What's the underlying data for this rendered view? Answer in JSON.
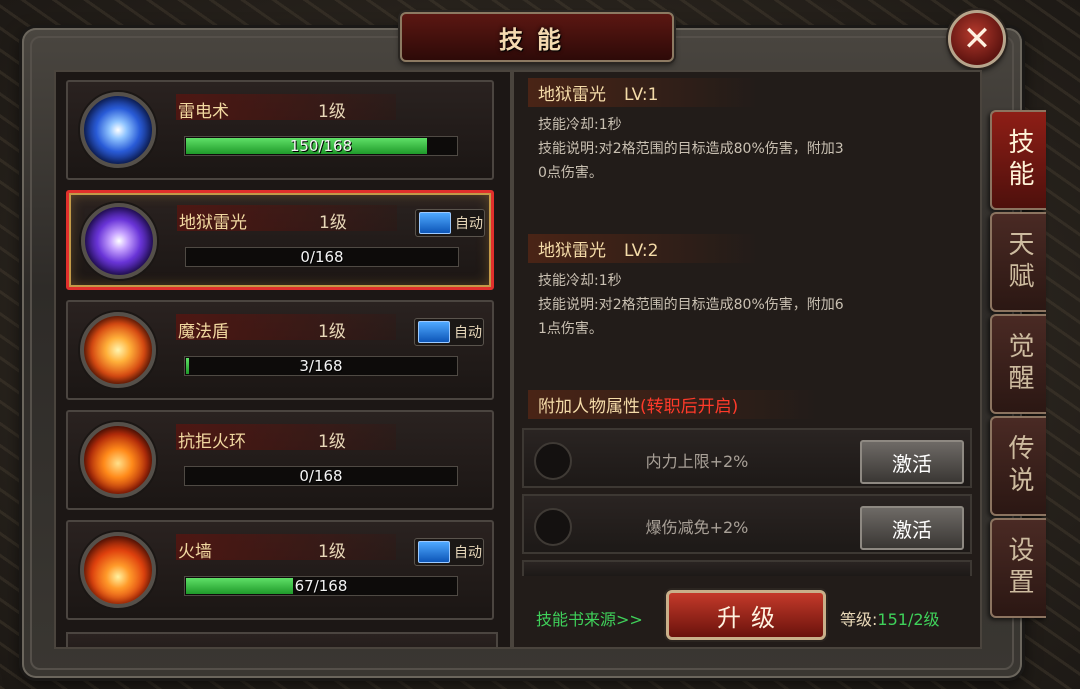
{
  "window": {
    "title": "技能",
    "close_icon": "✕"
  },
  "skills": [
    {
      "name": "雷电术",
      "level": "1级",
      "progress_text": "150/168",
      "progress": 0.893,
      "auto": false,
      "icon": "lightning-skill-icon"
    },
    {
      "name": "地狱雷光",
      "level": "1级",
      "progress_text": "0/168",
      "progress": 0.0,
      "auto": true,
      "auto_label": "自动",
      "icon": "hell-lightning-skill-icon"
    },
    {
      "name": "魔法盾",
      "level": "1级",
      "progress_text": "3/168",
      "progress": 0.018,
      "auto": true,
      "auto_label": "自动",
      "icon": "magic-shield-skill-icon"
    },
    {
      "name": "抗拒火环",
      "level": "1级",
      "progress_text": "0/168",
      "progress": 0.0,
      "auto": false,
      "icon": "repel-fire-ring-skill-icon"
    },
    {
      "name": "火墙",
      "level": "1级",
      "progress_text": "67/168",
      "progress": 0.399,
      "auto": true,
      "auto_label": "自动",
      "icon": "fire-wall-skill-icon"
    }
  ],
  "detail": {
    "current": {
      "name": "地狱雷光",
      "lv": "LV:1",
      "cooldown": "技能冷却:1秒",
      "desc_line1": "技能说明:对2格范围的目标造成80%伤害，附加3",
      "desc_line2": "0点伤害。"
    },
    "next": {
      "name": "地狱雷光",
      "lv": "LV:2",
      "cooldown": "技能冷却:1秒",
      "desc_line1": "技能说明:对2格范围的目标造成80%伤害，附加6",
      "desc_line2": "1点伤害。"
    },
    "attr_heading": "附加人物属性",
    "attr_note": "(转职后开启)",
    "attrs": [
      {
        "text": "内力上限+2%",
        "button": "激活"
      },
      {
        "text": "爆伤减免+2%",
        "button": "激活"
      }
    ],
    "book_source": "技能书来源>>",
    "upgrade_label": "升级",
    "level_label": "等级:",
    "level_value": "151/2级"
  },
  "side_tabs": [
    {
      "label": "技能",
      "active": true
    },
    {
      "label": "天赋",
      "active": false
    },
    {
      "label": "觉醒",
      "active": false
    },
    {
      "label": "传说",
      "active": false
    },
    {
      "label": "设置",
      "active": false
    }
  ],
  "colors": {
    "accent_red": "#e0302c",
    "progress_green": "#3fd15a",
    "note_red": "#ff3a2a"
  }
}
